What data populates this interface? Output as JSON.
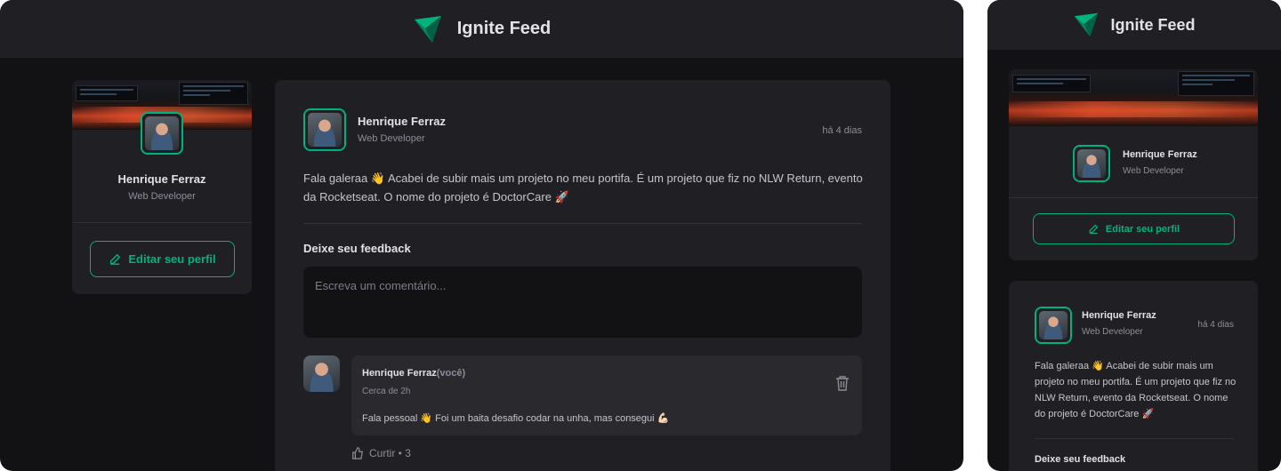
{
  "app": {
    "title": "Ignite Feed"
  },
  "colors": {
    "accent": "#00b37e",
    "background": "#121214",
    "surface": "#202024"
  },
  "profile": {
    "name": "Henrique Ferraz",
    "role": "Web Developer",
    "edit_label": "Editar seu perfil",
    "edit_icon": "pencil-icon"
  },
  "post": {
    "author": "Henrique Ferraz",
    "role": "Web Developer",
    "time": "há 4 dias",
    "content": "Fala galeraa 👋 Acabei de subir mais um projeto no meu portifa. É um projeto que fiz no NLW Return, evento da Rocketseat. O nome do projeto é DoctorCare 🚀",
    "feedback_title": "Deixe seu feedback",
    "comment_placeholder": "Escreva um comentário..."
  },
  "comment": {
    "author": "Henrique Ferraz",
    "you_label": "(você)",
    "time": "Cerca de 2h",
    "content": "Fala pessoal 👋 Foi um baita desafio codar na unha, mas consegui 💪🏻",
    "like_label": "Curtir • 3",
    "like_icon": "thumbs-up-icon",
    "delete_icon": "trash-icon"
  }
}
